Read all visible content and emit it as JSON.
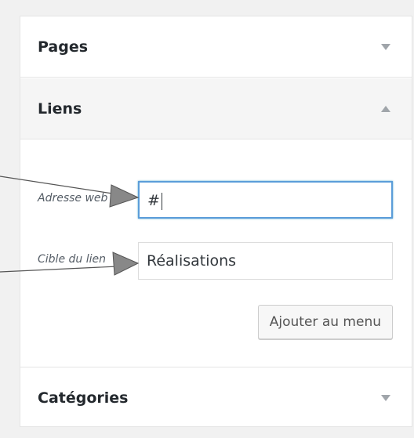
{
  "sections": {
    "pages": {
      "title": "Pages"
    },
    "liens": {
      "title": "Liens",
      "url_label": "Adresse web",
      "url_value": "#",
      "link_text_label": "Cible du lien",
      "link_text_value": "Réalisations",
      "add_button": "Ajouter au menu"
    },
    "categories": {
      "title": "Catégories"
    }
  },
  "colors": {
    "background": "#f1f1f1",
    "panel": "#ffffff",
    "focus_border": "#5b9dd9",
    "arrow": "#a0a5aa"
  },
  "icons": {
    "pages_toggle": "triangle-down-icon",
    "liens_toggle": "triangle-up-icon",
    "categories_toggle": "triangle-down-icon",
    "annotation": "arrow-pointer-icon"
  }
}
